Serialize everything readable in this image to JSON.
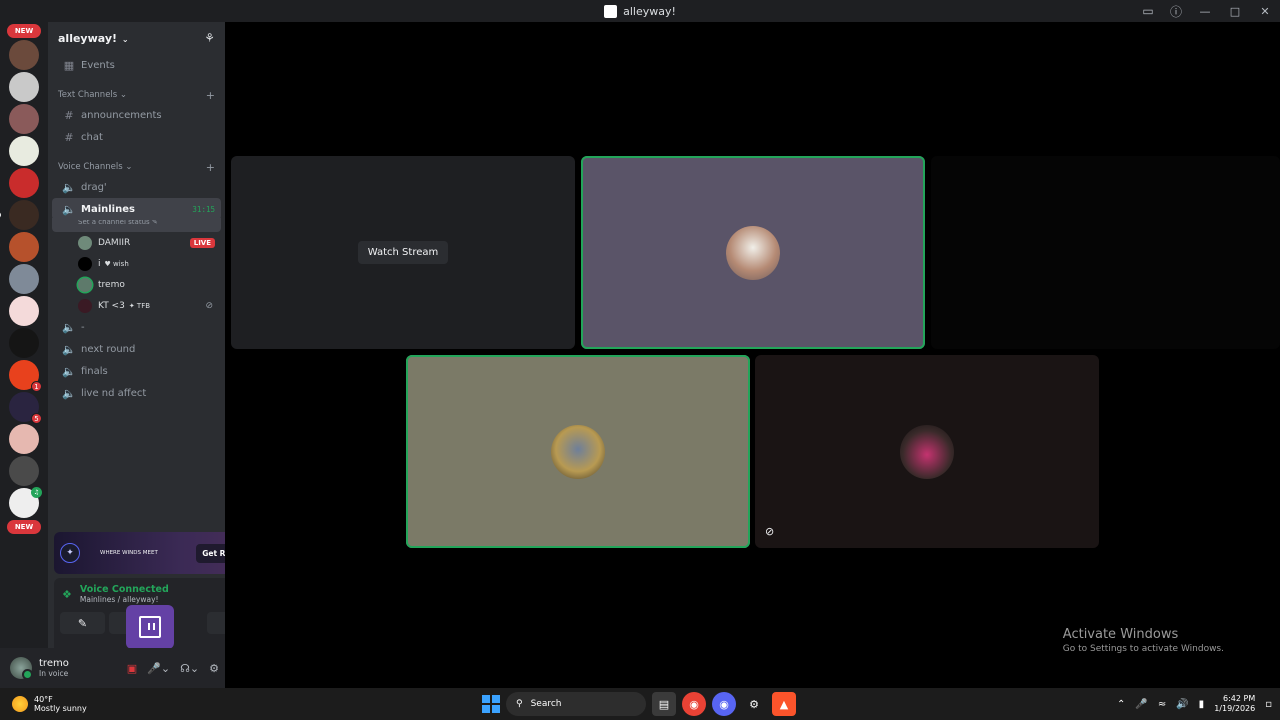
{
  "window": {
    "title": "alleyway!"
  },
  "rail": {
    "new_top": "NEW",
    "new_bottom": "NEW",
    "badges": [
      "1",
      "5"
    ]
  },
  "sidebar": {
    "guild_name": "alleyway!",
    "events_label": "Events",
    "text_category": "Text Channels",
    "text_channels": [
      "announcements",
      "chat"
    ],
    "voice_category": "Voice Channels",
    "voice_channels": {
      "drag": "drag'",
      "active": "Mainlines",
      "active_timer": "31:15",
      "active_status": "Set a channel status",
      "dash": "-",
      "next_round": "next round",
      "finals": "finals",
      "live": "live nd affect"
    },
    "members": [
      {
        "name": "DAMIIR",
        "badge": "LIVE"
      },
      {
        "name": "i",
        "tag": "♥ wish"
      },
      {
        "name": "tremo"
      },
      {
        "name": "KT <3",
        "tag": "✦ TFB"
      }
    ]
  },
  "promo": {
    "text": "WHERE WINDS MEET",
    "button": "Get Reward!"
  },
  "voice_panel": {
    "status": "Voice Connected",
    "location": "Mainlines / alleyway!"
  },
  "user": {
    "name": "tremo",
    "status": "In voice"
  },
  "stage": {
    "watch_label": "Watch Stream"
  },
  "watermark": {
    "line1": "Activate Windows",
    "line2": "Go to Settings to activate Windows."
  },
  "taskbar": {
    "temp": "40°F",
    "weather": "Mostly sunny",
    "search": "Search",
    "time": "6:42 PM",
    "date": "1/19/2026"
  },
  "colors": {
    "speaking": "#23a55a",
    "live": "#da373c",
    "twitch": "#6441a5"
  }
}
